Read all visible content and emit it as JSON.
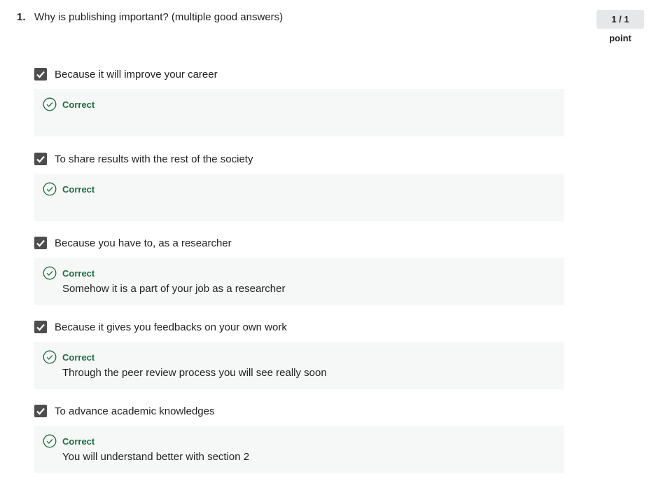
{
  "question": {
    "number": "1.",
    "text": "Why is publishing important? (multiple good answers)",
    "score": "1 / 1 point"
  },
  "options": [
    {
      "label": "Because it will improve your career",
      "checked": true,
      "status": "Correct",
      "explanation": ""
    },
    {
      "label": "To share results with the rest of the society",
      "checked": true,
      "status": "Correct",
      "explanation": ""
    },
    {
      "label": "Because you have to, as a researcher",
      "checked": true,
      "status": "Correct",
      "explanation": "Somehow it is a part of your job as a researcher"
    },
    {
      "label": "Because it gives you feedbacks on your own work",
      "checked": true,
      "status": "Correct",
      "explanation": "Through the peer review process you will see really soon"
    },
    {
      "label": "To advance academic knowledges",
      "checked": true,
      "status": "Correct",
      "explanation": "You will understand better with section 2"
    }
  ],
  "colors": {
    "checkbox": "#4d4d4d",
    "correct_text": "#1e6b41",
    "feedback_bg": "#f5f8f6",
    "score_bg": "#e5e7e8"
  },
  "icons": {
    "checkbox": "checkmark-icon",
    "feedback": "check-circle-icon"
  }
}
